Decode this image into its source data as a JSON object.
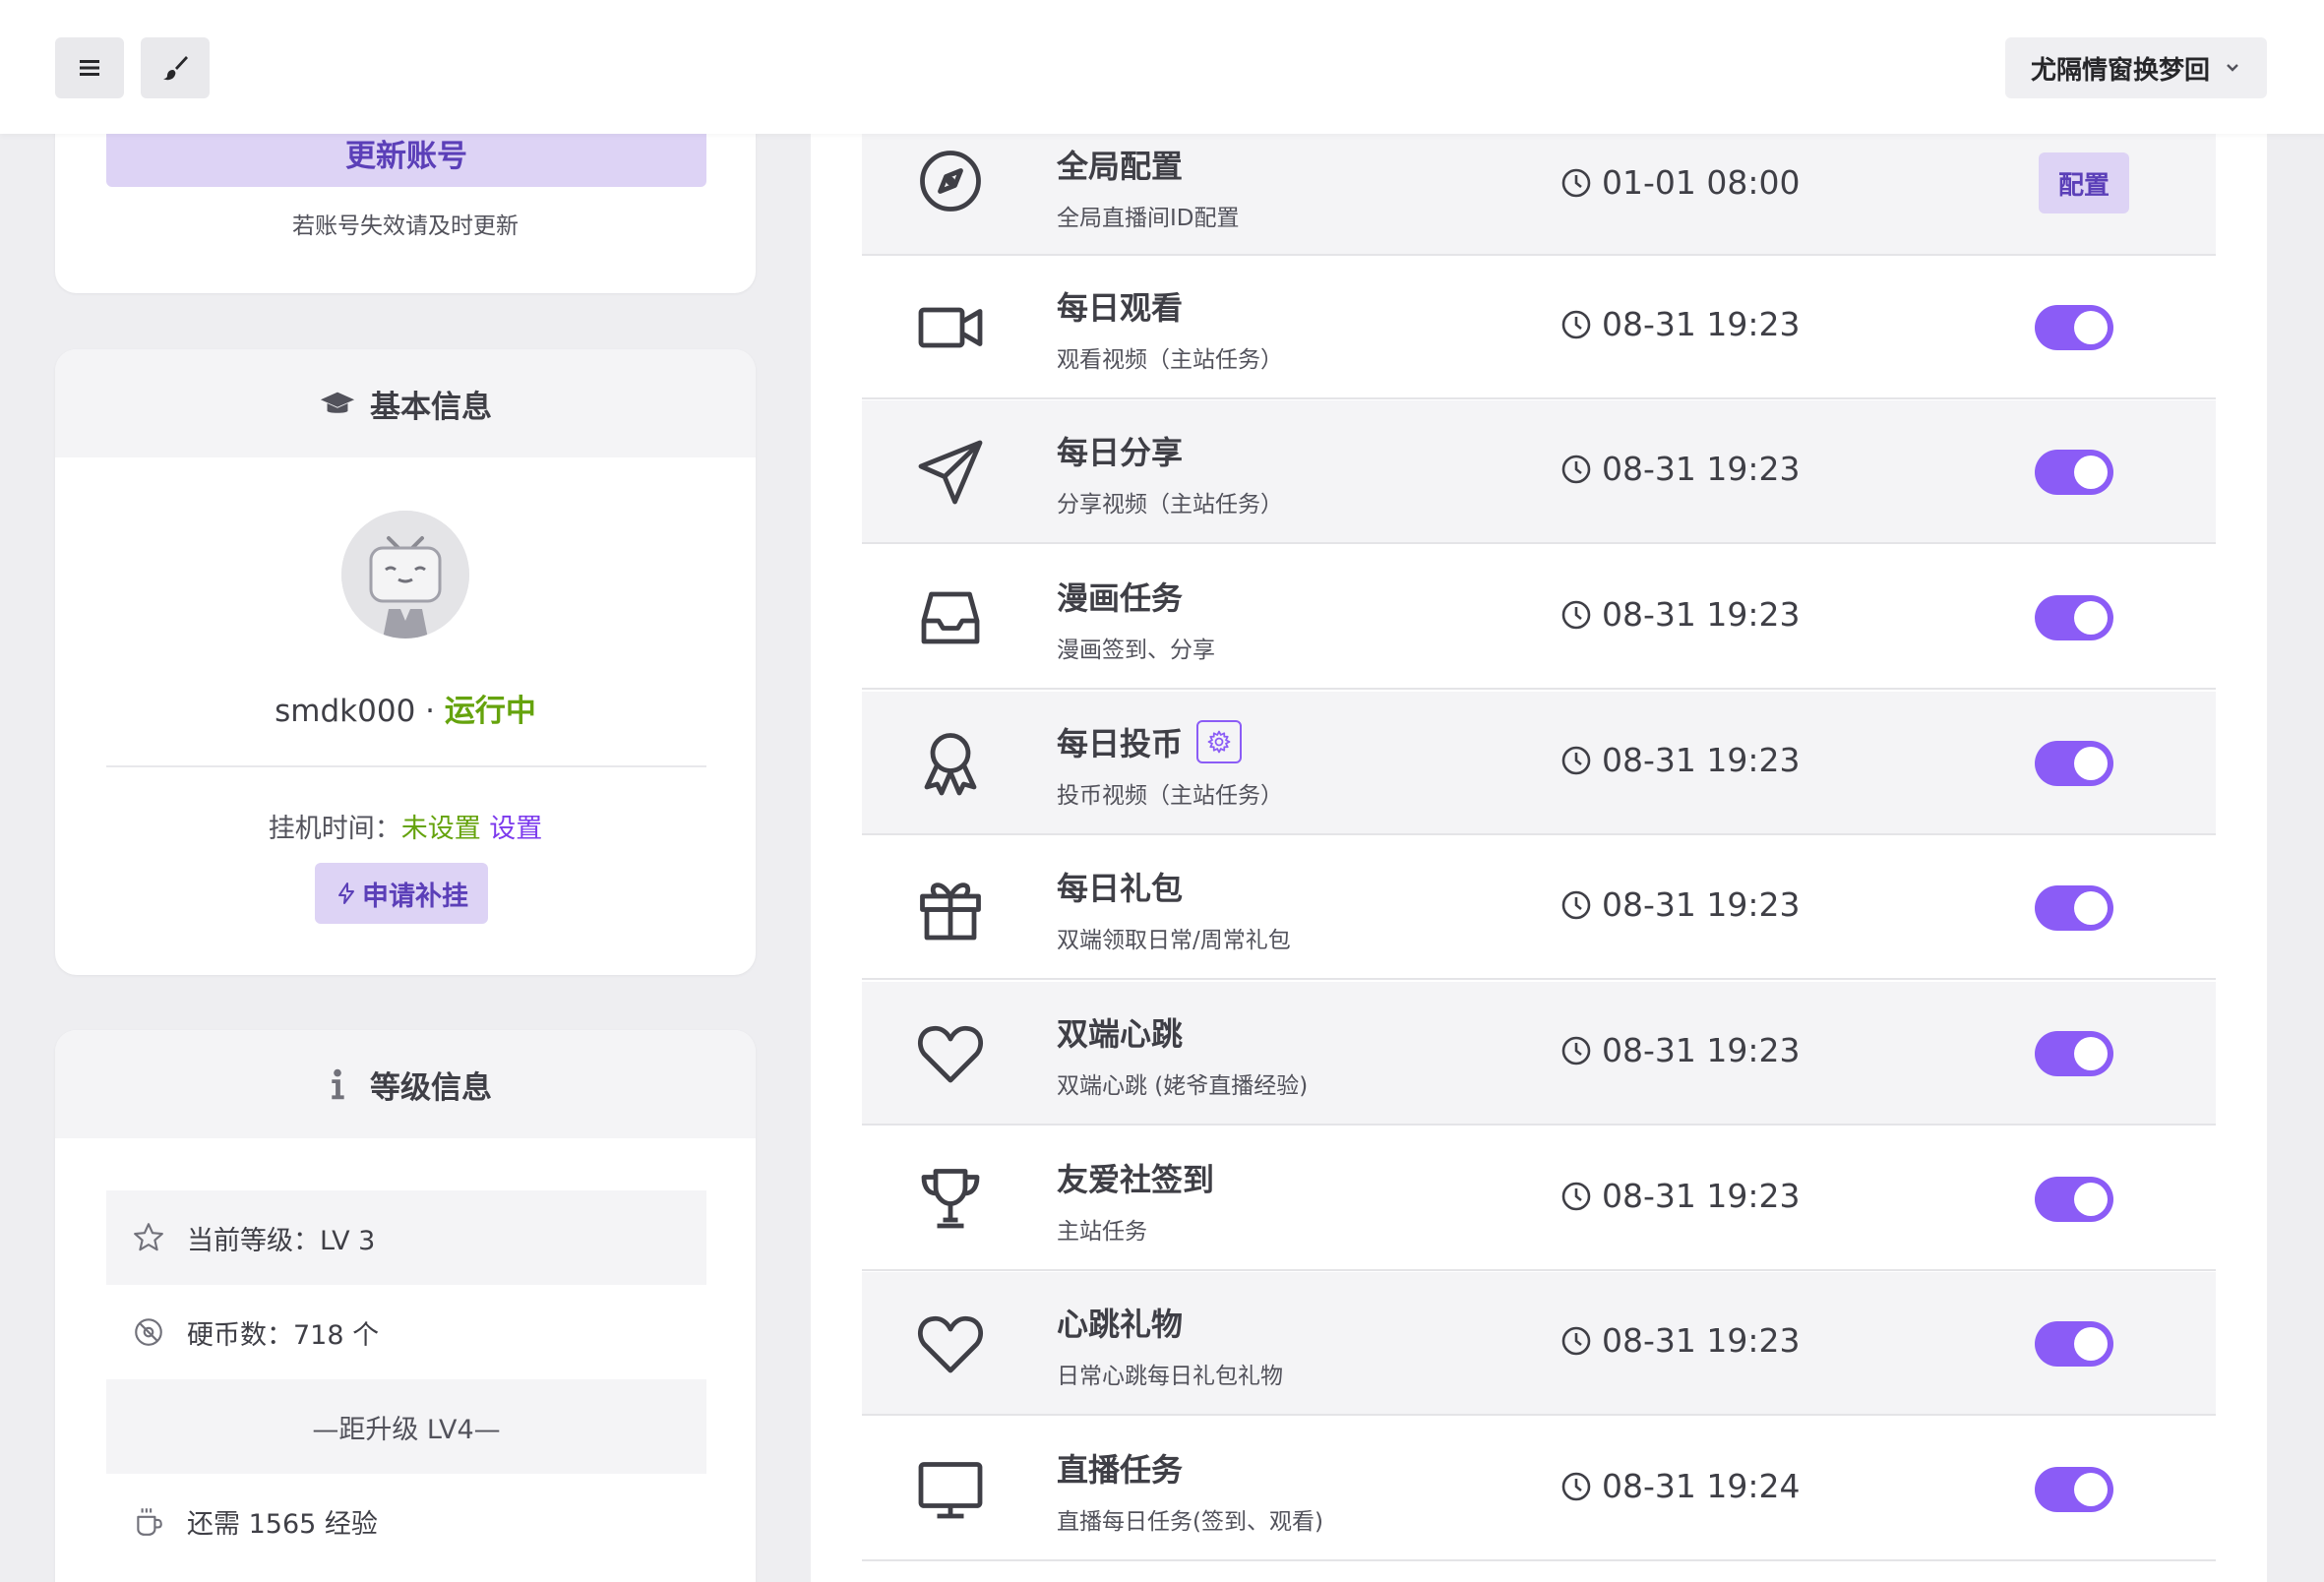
{
  "header": {
    "menu_icon": "hamburger-icon",
    "theme_icon": "paintbrush-icon",
    "user_name": "尤隔情窗换梦回"
  },
  "account": {
    "update_button": "更新账号",
    "hint": "若账号失效请及时更新"
  },
  "basic_info": {
    "title": "基本信息",
    "username": "smdk000",
    "separator": " · ",
    "status": "运行中",
    "hang_label": "挂机时间：",
    "hang_value": "未设置",
    "set_link": "设置",
    "apply_button": "申请补挂"
  },
  "level_info": {
    "title": "等级信息",
    "current_level": "当前等级：LV 3",
    "coins": "硬币数：718 个",
    "next_level": "—距升级 LV4—",
    "exp_needed": "还需 1565 经验"
  },
  "tasks": [
    {
      "name": "全局配置",
      "desc": "全局直播间ID配置",
      "time": "01-01 08:00",
      "icon": "compass-icon",
      "action": "配置"
    },
    {
      "name": "每日观看",
      "desc": "观看视频（主站任务）",
      "time": "08-31 19:23",
      "icon": "video-camera-icon",
      "enabled": true
    },
    {
      "name": "每日分享",
      "desc": "分享视频（主站任务）",
      "time": "08-31 19:23",
      "icon": "paper-plane-icon",
      "enabled": true
    },
    {
      "name": "漫画任务",
      "desc": "漫画签到、分享",
      "time": "08-31 19:23",
      "icon": "inbox-icon",
      "enabled": true
    },
    {
      "name": "每日投币",
      "desc": "投币视频（主站任务）",
      "time": "08-31 19:23",
      "icon": "award-ribbon-icon",
      "enabled": true,
      "has_settings": true
    },
    {
      "name": "每日礼包",
      "desc": "双端领取日常/周常礼包",
      "time": "08-31 19:23",
      "icon": "gift-icon",
      "enabled": true
    },
    {
      "name": "双端心跳",
      "desc": "双端心跳 (姥爷直播经验)",
      "time": "08-31 19:23",
      "icon": "heart-icon",
      "enabled": true
    },
    {
      "name": "友爱社签到",
      "desc": "主站任务",
      "time": "08-31 19:23",
      "icon": "trophy-icon",
      "enabled": true
    },
    {
      "name": "心跳礼物",
      "desc": "日常心跳每日礼包礼物",
      "time": "08-31 19:23",
      "icon": "heart-icon",
      "enabled": true
    },
    {
      "name": "直播任务",
      "desc": "直播每日任务(签到、观看)",
      "time": "08-31 19:24",
      "icon": "monitor-icon",
      "enabled": true
    }
  ],
  "colors": {
    "accent": "#8b5cf6",
    "accent_light": "#ddd3f5",
    "accent_text": "#5b3fb8",
    "running_green": "#65a30d"
  }
}
